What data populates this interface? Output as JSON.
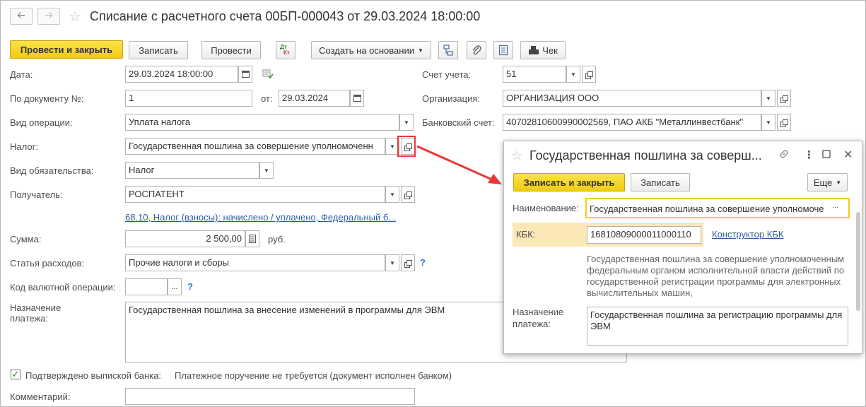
{
  "header": {
    "back_icon": "arrow-left-icon",
    "forward_icon": "arrow-right-icon",
    "favorite_icon": "star-icon",
    "title": "Списание с расчетного счета 00БП-000043 от 29.03.2024 18:00:00"
  },
  "toolbar": {
    "post_close": "Провести и закрыть",
    "save": "Записать",
    "post": "Провести",
    "dtkt_top": "Дт",
    "dtkt_bottom": "Кт",
    "create_based": "Создать на основании",
    "check": "Чек"
  },
  "form": {
    "date_label": "Дата:",
    "date_value": "29.03.2024 18:00:00",
    "doc_no_label": "По документу №:",
    "doc_no_value": "1",
    "from_label": "от:",
    "from_value": "29.03.2024",
    "operation_label": "Вид операции:",
    "operation_value": "Уплата налога",
    "tax_label": "Налог:",
    "tax_value": "Государственная пошлина за совершение уполномоченн",
    "obligation_label": "Вид обязательства:",
    "obligation_value": "Налог",
    "recipient_label": "Получатель:",
    "recipient_value": "РОСПАТЕНТ",
    "accounts_link": "68.10, Налог (взносы): начислено / уплачено, Федеральный б...",
    "sum_label": "Сумма:",
    "sum_value": "2 500,00",
    "currency": "руб.",
    "expense_label": "Статья расходов:",
    "expense_value": "Прочие налоги и сборы",
    "currency_op_label": "Код валютной операции:",
    "currency_op_value": "",
    "purpose_label_1": "Назначение",
    "purpose_label_2": "платежа:",
    "purpose_value": "Государственная пошлина за внесение изменений в программы для ЭВМ",
    "confirmed_label": "Подтверждено выпиской банка:",
    "payment_order_text": "Платежное поручение не требуется (документ исполнен банком)",
    "comment_label": "Комментарий:",
    "comment_value": "",
    "account_label": "Счет учета:",
    "account_value": "51",
    "org_label": "Организация:",
    "org_value": "ОРГАНИЗАЦИЯ ООО",
    "bank_label": "Банковский счет:",
    "bank_value": "40702810600990002569, ПАО АКБ \"Металлинвестбанк\"",
    "help": "?"
  },
  "popup": {
    "title": "Государственная пошлина за соверш...",
    "save_close": "Записать и закрыть",
    "save": "Записать",
    "more": "Еще",
    "name_label": "Наименование:",
    "name_value": "Государственная пошлина за совершение уполномоче",
    "kbk_label": "КБК:",
    "kbk_value": "16810809000011000110",
    "kbk_link": "Конструктор КБК",
    "description": "Государственная пошлина за совершение уполномоченным федеральным органом исполнительной власти действий по государственной регистрации программы для электронных вычислительных машин,",
    "purpose_label_1": "Назначение",
    "purpose_label_2": "платежа:",
    "purpose_value": "Государственная пошлина за регистрацию программы для ЭВМ",
    "ellipsis": "..."
  },
  "colors": {
    "accent_yellow": "#f2cc12",
    "link_blue": "#2b5aa3",
    "kbk_highlight": "#fbe7b8",
    "arrow_red": "#e8393a",
    "check_green": "#1a8a1a"
  }
}
